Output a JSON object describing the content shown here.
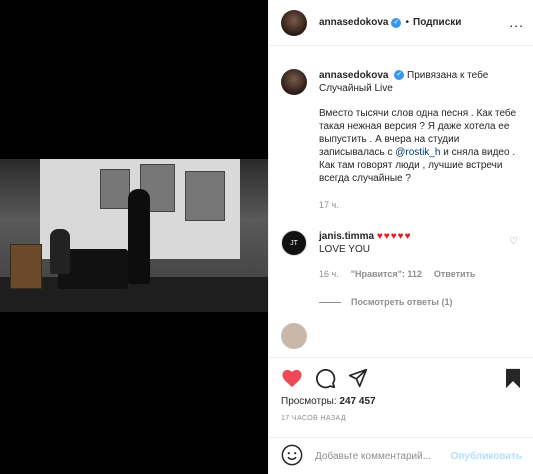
{
  "header": {
    "username": "annasedokova",
    "dot": "•",
    "follow_label": "Подписки",
    "more": "..."
  },
  "caption": {
    "username": "annasedokova",
    "intro": "Привязана к тебе",
    "subtitle": "Случайный Live",
    "text_before_mention": "Вместо тысячи слов одна песня . Как тебе такая нежная версия ? Я даже хотела ее выпустить . А вчера на студии записывалась с ",
    "mention": "@rostik_h",
    "text_after_mention": " и сняла видео . Как там говорят люди , лучшие встречи всегда случайные ?",
    "time": "17 ч."
  },
  "comment": {
    "avatar_text": "JT",
    "username": "janis.timma",
    "hearts": "♥♥♥♥♥",
    "text": "LOVE YOU",
    "time": "16 ч.",
    "likes": "\"Нравится\": 112",
    "reply": "Ответить",
    "view_replies": "Посмотреть ответы (1)"
  },
  "actions": {
    "views_label": "Просмотры:",
    "views_count": "247 457",
    "ago": "17 ЧАСОВ НАЗАД"
  },
  "add_comment": {
    "placeholder": "Добавьте комментарий...",
    "publish_label": "Опубликовать"
  },
  "icons": {
    "like": "heart-icon",
    "comment": "comment-icon",
    "share": "share-icon",
    "save": "bookmark-icon",
    "emoji": "emoji-icon",
    "like_color": "#ed4956"
  }
}
